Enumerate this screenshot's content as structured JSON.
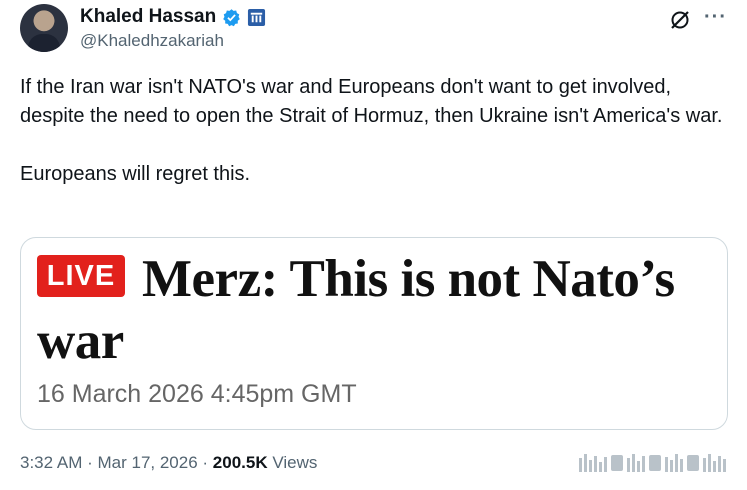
{
  "author": {
    "display_name": "Khaled Hassan",
    "handle": "@Khaledhzakariah"
  },
  "tweet": {
    "paragraph1": "If the Iran war isn't NATO's war and Europeans don't want to get involved, despite the need to open the Strait of Hormuz, then Ukraine isn't America's war.",
    "paragraph2": "Europeans will regret this."
  },
  "card": {
    "badge": "LIVE",
    "headline": "Merz: This is not Nato’s war",
    "date": "16 March 2026 4:45pm GMT"
  },
  "footer": {
    "time": "3:32 AM",
    "separator1": " · ",
    "date": "Mar 17, 2026",
    "separator2": " · ",
    "views_count": "200.5K",
    "views_label": " Views"
  },
  "colors": {
    "verified_blue": "#1d9bf0",
    "live_red": "#e2211c",
    "secondary_text": "#536471"
  },
  "icons": [
    "verified-badge-icon",
    "affiliate-icon",
    "grok-icon",
    "more-icon",
    "stats-icon"
  ]
}
